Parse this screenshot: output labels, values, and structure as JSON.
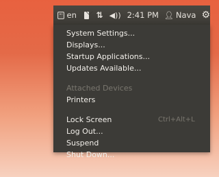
{
  "panel": {
    "language": "en",
    "time": "2:41 PM",
    "user": "Nava",
    "icons": [
      "keyboard-icon",
      "mail-icon",
      "network-icon",
      "volume-icon",
      "user-icon",
      "gear-icon"
    ]
  },
  "menu": {
    "items": [
      {
        "label": "System Settings...",
        "enabled": true
      },
      {
        "label": "Displays...",
        "enabled": true
      },
      {
        "label": "Startup Applications...",
        "enabled": true
      },
      {
        "label": "Updates Available...",
        "enabled": true
      },
      {
        "label": "Attached Devices",
        "enabled": false
      },
      {
        "label": "Printers",
        "enabled": true
      },
      {
        "label": "Lock Screen",
        "enabled": true,
        "shortcut": "Ctrl+Alt+L"
      },
      {
        "label": "Log Out...",
        "enabled": true
      },
      {
        "label": "Suspend",
        "enabled": true
      },
      {
        "label": "Shut Down...",
        "enabled": true
      }
    ]
  }
}
